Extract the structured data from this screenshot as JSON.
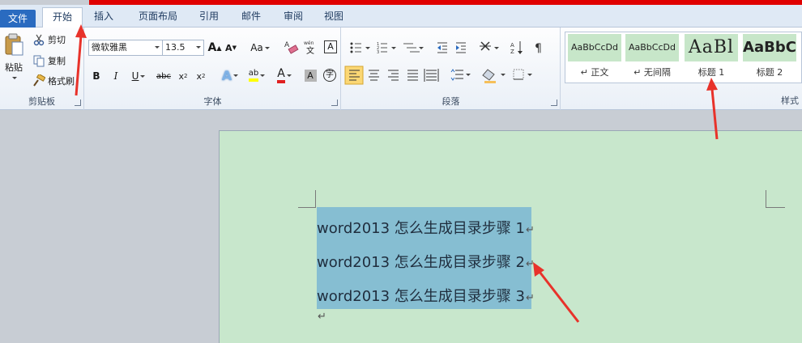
{
  "tabs": [
    {
      "label": "文件"
    },
    {
      "label": "开始"
    },
    {
      "label": "插入"
    },
    {
      "label": "页面布局"
    },
    {
      "label": "引用"
    },
    {
      "label": "邮件"
    },
    {
      "label": "审阅"
    },
    {
      "label": "视图"
    }
  ],
  "clipboard": {
    "paste": "粘贴",
    "cut": "剪切",
    "copy": "复制",
    "format_painter": "格式刷",
    "group": "剪贴板"
  },
  "font": {
    "name": "微软雅黑",
    "size": "13.5",
    "group": "字体"
  },
  "paragraph": {
    "group": "段落"
  },
  "styles": {
    "group": "样式",
    "items": [
      {
        "sample": "AaBbCcDd",
        "name": "↵ 正文"
      },
      {
        "sample": "AaBbCcDd",
        "name": "↵ 无间隔"
      },
      {
        "sample": "AaBl",
        "name": "标题 1"
      },
      {
        "sample": "AaBbC",
        "name": "标题 2"
      }
    ]
  },
  "document": {
    "lines": [
      "word2013 怎么生成目录步骤 1",
      "word2013 怎么生成目录步骤 2",
      "word2013 怎么生成目录步骤 3"
    ],
    "pilcrow": "↵"
  },
  "colors": {
    "page": "#c8e7cc",
    "selection": "#86bed2",
    "accent": "#2a6bc0",
    "arrow": "#e8322a",
    "top_bar": "#e00000"
  }
}
